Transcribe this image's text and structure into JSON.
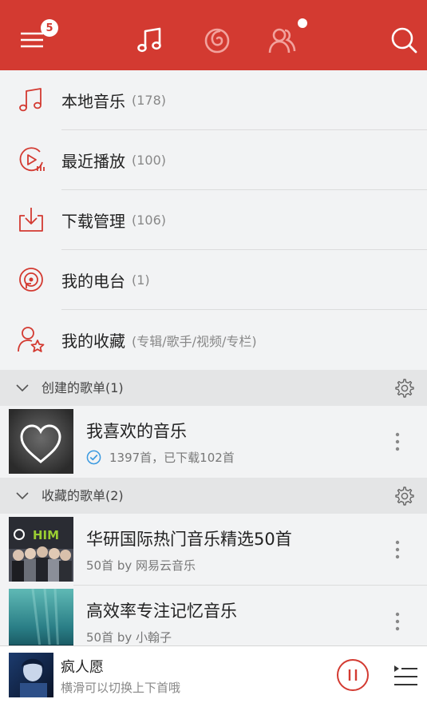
{
  "header": {
    "notification_count": "5",
    "tabs": [
      "music-note-icon",
      "netease-radio-icon",
      "friends-icon"
    ],
    "accent_color": "#d33a31"
  },
  "menu": {
    "items": [
      {
        "label": "本地音乐",
        "count": "(178)",
        "icon": "music-note-icon"
      },
      {
        "label": "最近播放",
        "count": "(100)",
        "icon": "recent-play-icon"
      },
      {
        "label": "下载管理",
        "count": "(106)",
        "icon": "download-icon"
      },
      {
        "label": "我的电台",
        "count": "(1)",
        "icon": "radio-icon"
      },
      {
        "label": "我的收藏",
        "count": "(专辑/歌手/视频/专栏)",
        "icon": "favorite-user-icon"
      }
    ]
  },
  "created_section": {
    "title": "创建的歌单(1)",
    "playlists": [
      {
        "title": "我喜欢的音乐",
        "subtitle": "1397首，已下载102首"
      }
    ]
  },
  "collected_section": {
    "title": "收藏的歌单(2)",
    "playlists": [
      {
        "title": "华研国际热门音乐精选50首",
        "subtitle": "50首 by 网易云音乐",
        "cover_text": "HIM"
      },
      {
        "title": "高效率专注记忆音乐",
        "subtitle": "50首 by 小翰子"
      }
    ]
  },
  "player": {
    "song_title": "疯人愿",
    "hint": "横滑可以切换上下首哦"
  }
}
